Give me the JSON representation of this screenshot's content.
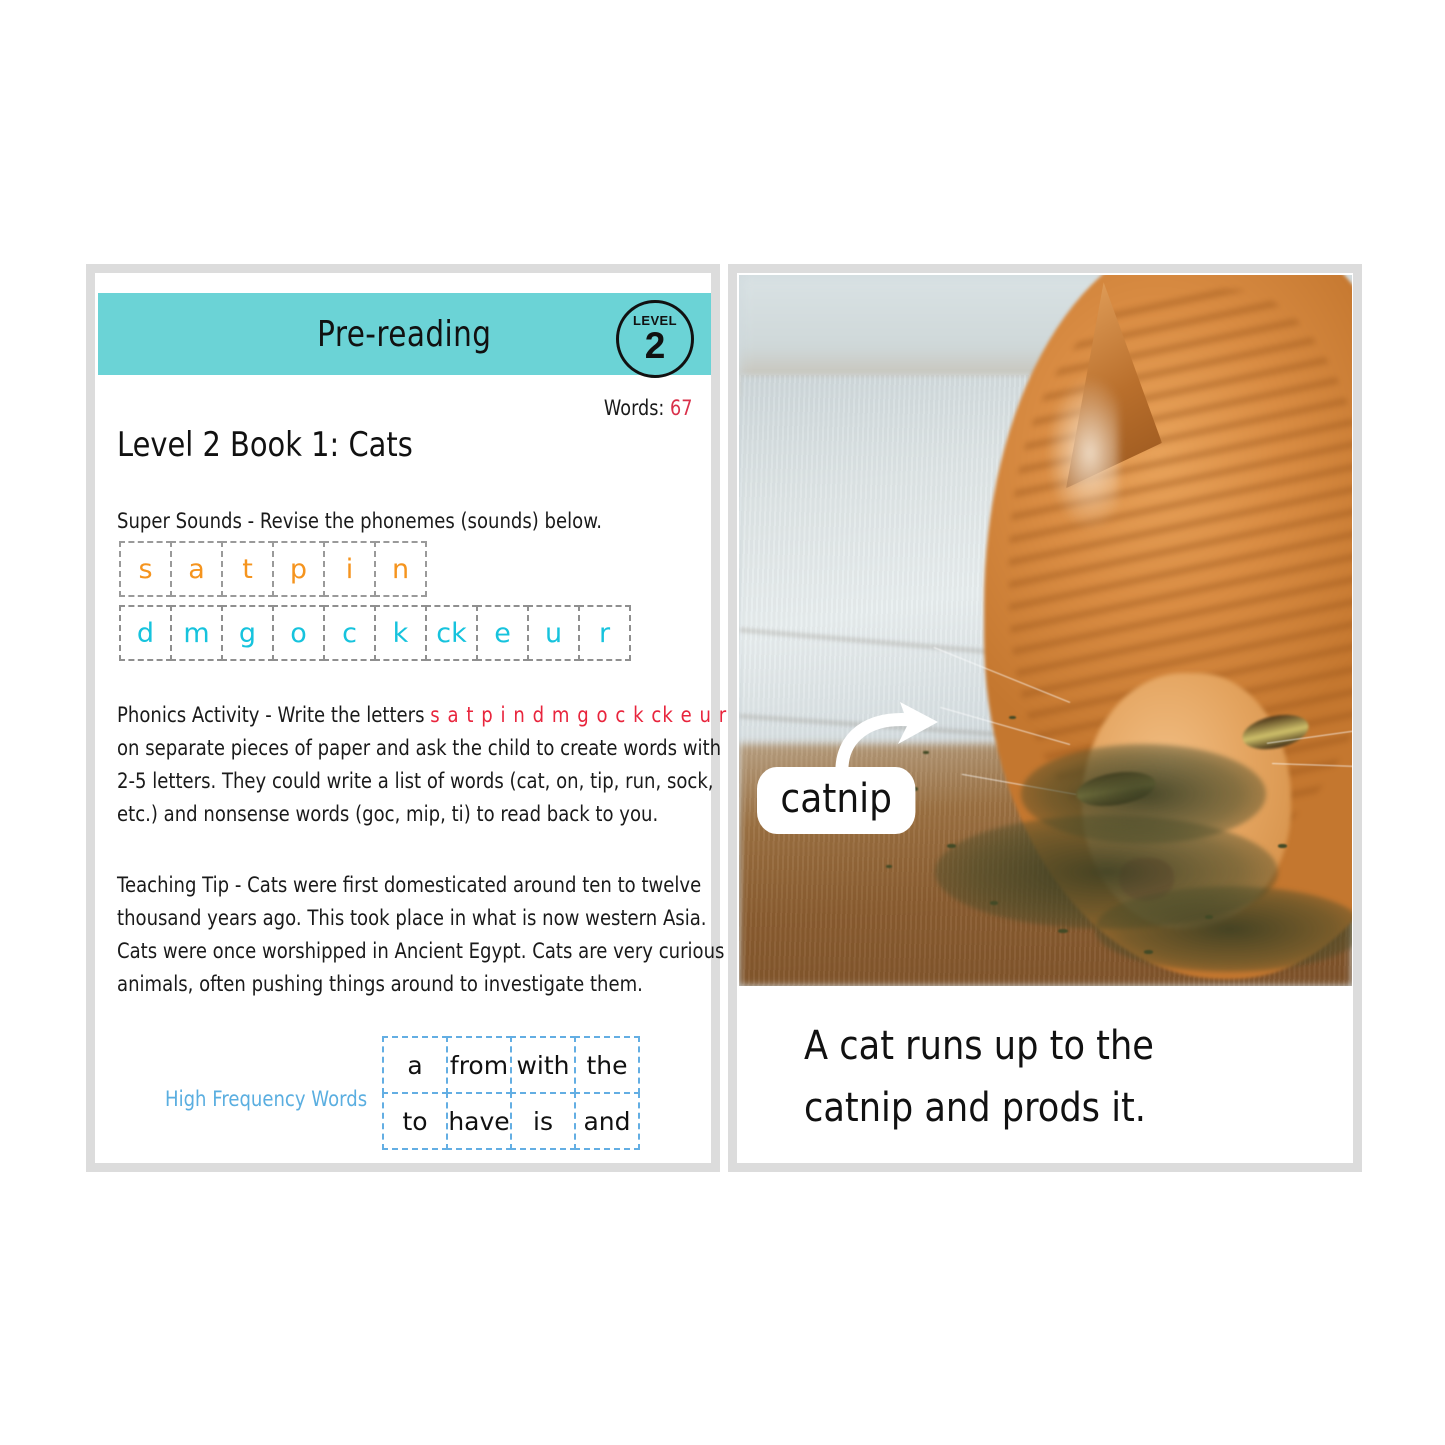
{
  "worksheet": {
    "header": {
      "title": "Pre-reading",
      "level_word": "LEVEL",
      "level_number": "2",
      "band_color": "#6bd3d6"
    },
    "words_count": {
      "label": "Words:",
      "value": "67",
      "value_color": "#d9304a"
    },
    "book_title": "Level 2 Book 1: Cats",
    "super_sounds": {
      "label": "Super Sounds - Revise the phonemes (sounds) below.",
      "row1": [
        "s",
        "a",
        "t",
        "p",
        "i",
        "n"
      ],
      "row1_color": "#f5941e",
      "row2": [
        "d",
        "m",
        "g",
        "o",
        "c",
        "k",
        "ck",
        "e",
        "u",
        "r"
      ],
      "row2_color": "#16c3dd"
    },
    "phonics_activity": {
      "lead": "Phonics Activity - Write the letters",
      "letters": "s a t p i n d m g o c k ck e u r",
      "letters_color": "#e8243c",
      "line2": "on separate pieces of paper and ask the child to create words with",
      "line3": "2-5 letters. They could write a list of words (cat, on, tip, run, sock,",
      "line4": "etc.) and nonsense words (goc, mip, ti) to read back to you."
    },
    "teaching_tip": {
      "line1": "Teaching Tip - Cats were first domesticated around ten to twelve",
      "line2": "thousand years ago. This took place in what is now western Asia.",
      "line3": "Cats were once worshipped in Ancient Egypt. Cats are very curious",
      "line4": "animals, often pushing things around to investigate them."
    },
    "high_frequency_words": {
      "label": "High Frequency Words",
      "label_color": "#5aaee0",
      "row1": [
        "a",
        "from",
        "with",
        "the"
      ],
      "row2": [
        "to",
        "have",
        "is",
        "and"
      ]
    }
  },
  "book_page": {
    "photo": {
      "subject": "orange tabby cat sniffing catnip on wooden floor",
      "callout_label": "catnip",
      "arrow_icon": "curved-arrow-icon"
    },
    "caption": "A cat runs up to the catnip and prods it."
  }
}
